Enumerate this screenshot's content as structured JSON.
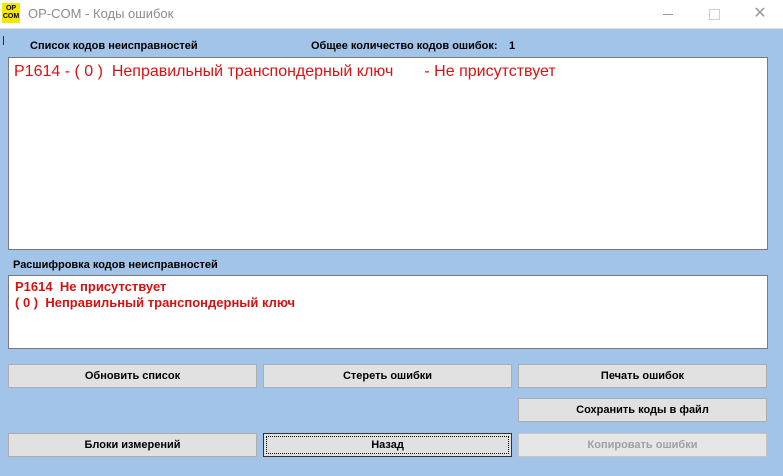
{
  "window": {
    "title": "OP-COM - Коды ошибок",
    "icon_text": "OP COM"
  },
  "faults": {
    "list_label": "Список кодов неисправностей",
    "total_label": "Общее количество кодов ошибок:",
    "total_count": "1",
    "items": [
      "P1614 - ( 0 )  Неправильный транспондерный ключ       - Не присутствует"
    ]
  },
  "decode": {
    "label": "Расшифровка кодов неисправностей",
    "lines": [
      "P1614  Не присутствует",
      "( 0 )  Неправильный транспондерный ключ"
    ]
  },
  "buttons": {
    "refresh": "Обновить список",
    "erase": "Стереть ошибки",
    "print": "Печать ошибок",
    "save": "Сохранить коды в файл",
    "blocks": "Блоки измерений",
    "back": "Назад",
    "copy": "Копировать ошибки"
  },
  "colors": {
    "background": "#a3c4e9",
    "fault_text": "#e01010"
  }
}
